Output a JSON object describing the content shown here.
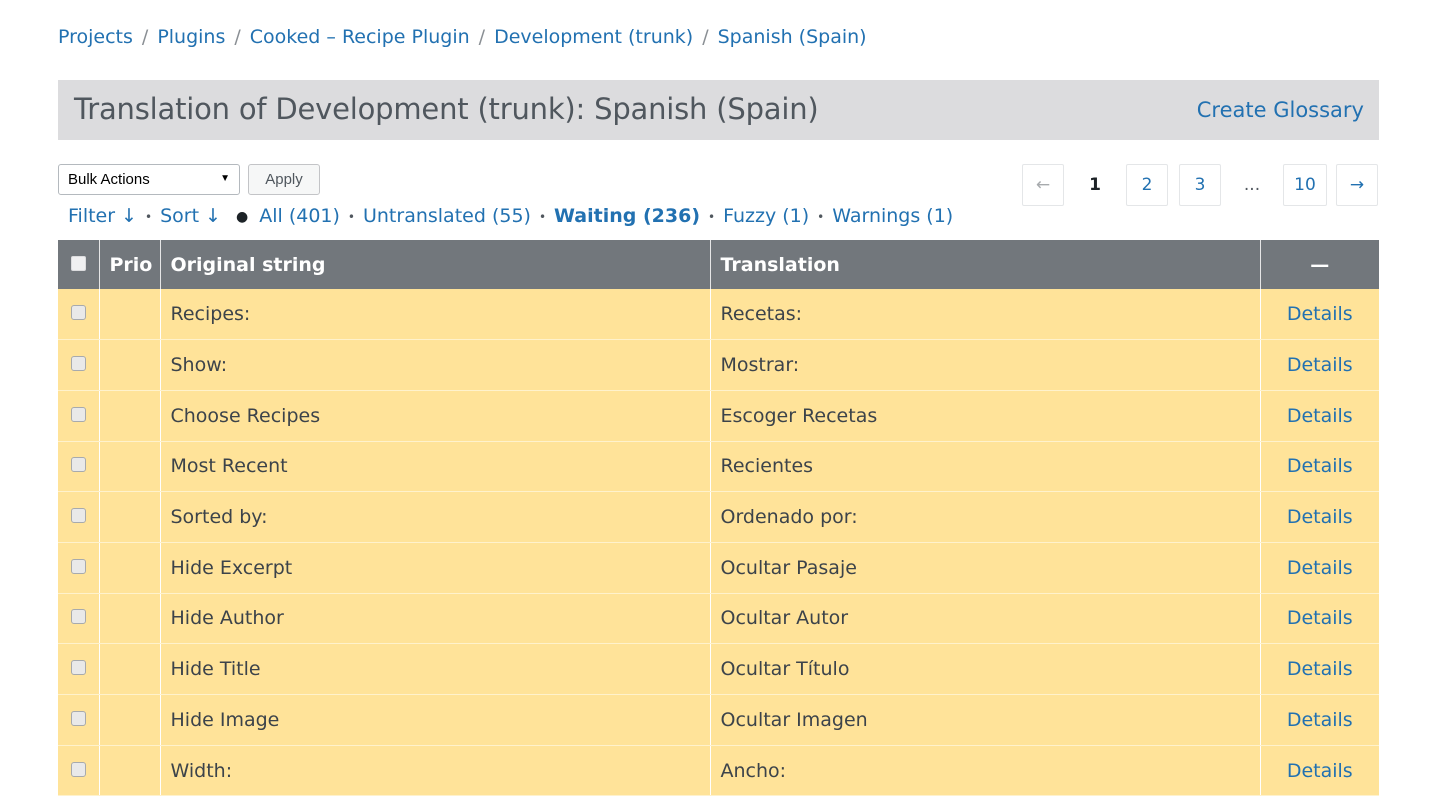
{
  "breadcrumb": {
    "items": [
      "Projects",
      "Plugins",
      "Cooked – Recipe Plugin",
      "Development (trunk)",
      "Spanish (Spain)"
    ],
    "separator": "/"
  },
  "header": {
    "title": "Translation of Development (trunk): Spanish (Spain)",
    "glossary_link": "Create Glossary"
  },
  "toolbar": {
    "bulk_actions": "Bulk Actions",
    "apply_label": "Apply"
  },
  "pagination": {
    "prev": "←",
    "pages": [
      "1",
      "2",
      "3"
    ],
    "ellipsis": "...",
    "last": "10",
    "next": "→",
    "current": "1"
  },
  "filters": {
    "filter_label": "Filter ↓",
    "sort_label": "Sort ↓",
    "views": [
      {
        "label": "All (401)",
        "active": false
      },
      {
        "label": "Untranslated (55)",
        "active": false
      },
      {
        "label": "Waiting (236)",
        "active": true
      },
      {
        "label": "Fuzzy (1)",
        "active": false
      },
      {
        "label": "Warnings (1)",
        "active": false
      }
    ]
  },
  "table": {
    "headers": {
      "prio": "Prio",
      "original": "Original string",
      "translation": "Translation",
      "actions": "—"
    },
    "details_label": "Details",
    "rows": [
      {
        "original": "Recipes:",
        "translation": "Recetas:"
      },
      {
        "original": "Show:",
        "translation": "Mostrar:"
      },
      {
        "original": "Choose Recipes",
        "translation": "Escoger Recetas"
      },
      {
        "original": "Most Recent",
        "translation": "Recientes"
      },
      {
        "original": "Sorted by:",
        "translation": "Ordenado por:"
      },
      {
        "original": "Hide Excerpt",
        "translation": "Ocultar Pasaje"
      },
      {
        "original": "Hide Author",
        "translation": "Ocultar Autor"
      },
      {
        "original": "Hide Title",
        "translation": "Ocultar Título"
      },
      {
        "original": "Hide Image",
        "translation": "Ocultar Imagen"
      },
      {
        "original": "Width:",
        "translation": "Ancho:"
      }
    ]
  },
  "colors": {
    "link": "#2271b1",
    "header_bg": "#72777c",
    "row_waiting_bg": "#ffe399",
    "title_bar_bg": "#dcdcde"
  }
}
